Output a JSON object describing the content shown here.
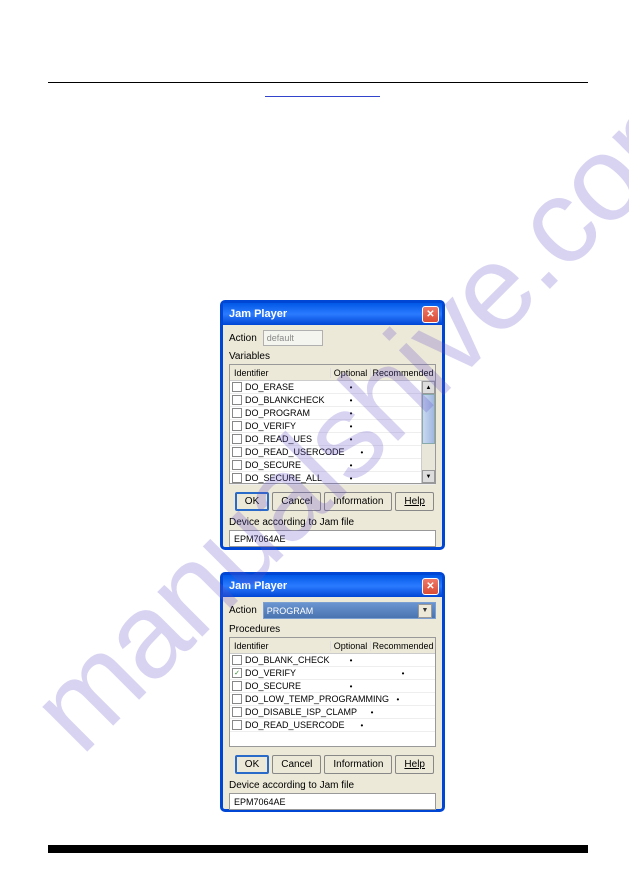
{
  "watermark": "manualshive.com",
  "dialog1": {
    "title": "Jam Player",
    "action_label": "Action",
    "action_value": "default",
    "section": "Variables",
    "headers": {
      "id": "Identifier",
      "opt": "Optional",
      "rec": "Recommended"
    },
    "rows": [
      {
        "id": "DO_ERASE",
        "opt": "•",
        "rec": "",
        "chk": false
      },
      {
        "id": "DO_BLANKCHECK",
        "opt": "•",
        "rec": "",
        "chk": false
      },
      {
        "id": "DO_PROGRAM",
        "opt": "•",
        "rec": "",
        "chk": false
      },
      {
        "id": "DO_VERIFY",
        "opt": "•",
        "rec": "",
        "chk": false
      },
      {
        "id": "DO_READ_UES",
        "opt": "•",
        "rec": "",
        "chk": false
      },
      {
        "id": "DO_READ_USERCODE",
        "opt": "•",
        "rec": "",
        "chk": false
      },
      {
        "id": "DO_SECURE",
        "opt": "•",
        "rec": "",
        "chk": false
      },
      {
        "id": "DO_SECURE_ALL",
        "opt": "•",
        "rec": "",
        "chk": false
      }
    ],
    "ok": "OK",
    "cancel": "Cancel",
    "info": "Information",
    "help": "Help",
    "device_label": "Device according to Jam file",
    "device_value": "EPM7064AE"
  },
  "dialog2": {
    "title": "Jam Player",
    "action_label": "Action",
    "action_value": "PROGRAM",
    "section": "Procedures",
    "headers": {
      "id": "Identifier",
      "opt": "Optional",
      "rec": "Recommended"
    },
    "rows": [
      {
        "id": "DO_BLANK_CHECK",
        "opt": "•",
        "rec": "",
        "chk": false
      },
      {
        "id": "DO_VERIFY",
        "opt": "",
        "rec": "•",
        "chk": true
      },
      {
        "id": "DO_SECURE",
        "opt": "•",
        "rec": "",
        "chk": false
      },
      {
        "id": "DO_LOW_TEMP_PROGRAMMING",
        "opt": "•",
        "rec": "",
        "chk": false
      },
      {
        "id": "DO_DISABLE_ISP_CLAMP",
        "opt": "•",
        "rec": "",
        "chk": false
      },
      {
        "id": "DO_READ_USERCODE",
        "opt": "•",
        "rec": "",
        "chk": false
      }
    ],
    "ok": "OK",
    "cancel": "Cancel",
    "info": "Information",
    "help": "Help",
    "device_label": "Device according to Jam file",
    "device_value": "EPM7064AE"
  }
}
